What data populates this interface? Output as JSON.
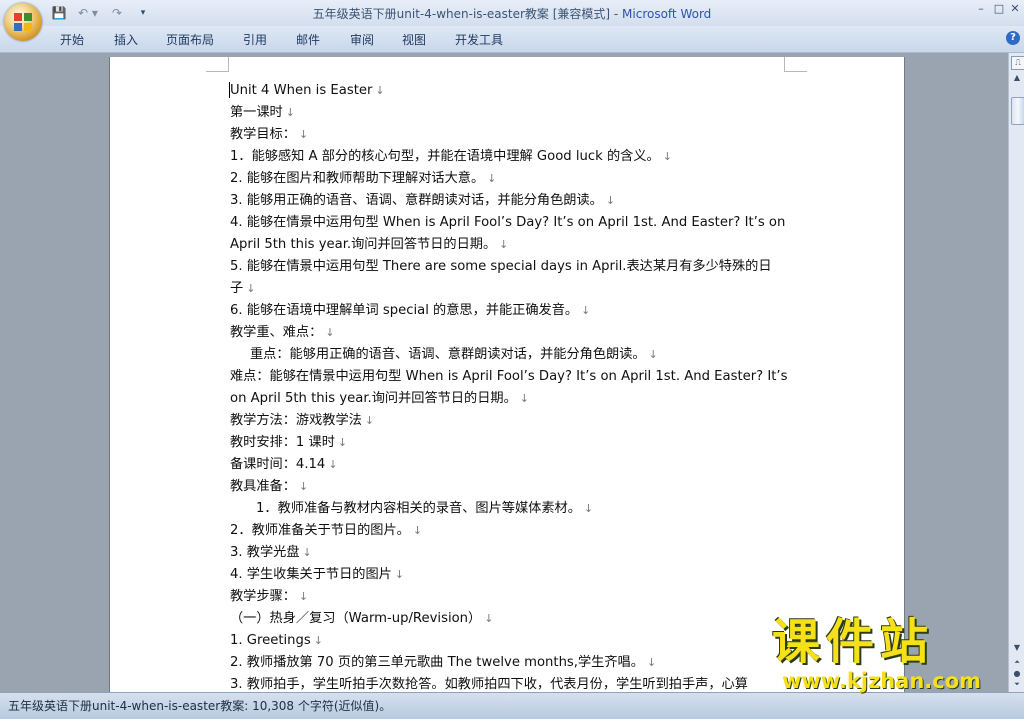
{
  "window": {
    "title_doc": "五年级英语下册unit-4-when-is-easter教案 [兼容模式] - ",
    "title_app": "Microsoft Word",
    "minimize": "–",
    "maximize": "□",
    "close": "✕"
  },
  "quick_access": {
    "save_icon": "💾",
    "undo_icon": "↶ ▾",
    "redo_icon": "↷",
    "customize_icon": "▾"
  },
  "ribbon": {
    "tabs": [
      "开始",
      "插入",
      "页面布局",
      "引用",
      "邮件",
      "审阅",
      "视图",
      "开发工具"
    ],
    "help_icon": "?"
  },
  "document": {
    "paragraph_mark": "↓",
    "lines": [
      {
        "text": "Unit 4 When is Easter",
        "indent": 0
      },
      {
        "text": "第一课时",
        "indent": 0
      },
      {
        "text": "教学目标：",
        "indent": 0
      },
      {
        "text": "1．能够感知 A 部分的核心句型，并能在语境中理解 Good luck 的含义。",
        "indent": 0
      },
      {
        "text": "2. 能够在图片和教师帮助下理解对话大意。",
        "indent": 0
      },
      {
        "text": "3. 能够用正确的语音、语调、意群朗读对话，并能分角色朗读。",
        "indent": 0
      },
      {
        "text": "4. 能够在情景中运用句型 When is April Fool’s Day? It’s on April 1st. And Easter? It’s on",
        "indent": 0,
        "nomark": true
      },
      {
        "text": "April 5th this year.询问并回答节日的日期。",
        "indent": 0
      },
      {
        "text": "5. 能够在情景中运用句型 There are some special days in April.表达某月有多少特殊的日",
        "indent": 0,
        "nomark": true
      },
      {
        "text": "子",
        "indent": 0
      },
      {
        "text": "6. 能够在语境中理解单词 special 的意思，并能正确发音。",
        "indent": 0
      },
      {
        "text": "教学重、难点：",
        "indent": 0
      },
      {
        "text": "重点：能够用正确的语音、语调、意群朗读对话，并能分角色朗读。",
        "indent": 1
      },
      {
        "text": "难点：能够在情景中运用句型 When is April Fool’s Day? It’s on April 1st. And Easter? It’s",
        "indent": 0,
        "nomark": true
      },
      {
        "text": "on April 5th this year.询问并回答节日的日期。",
        "indent": 0
      },
      {
        "text": "教学方法：游戏教学法",
        "indent": 0
      },
      {
        "text": "教时安排：1 课时",
        "indent": 0
      },
      {
        "text": "备课时间：4.14",
        "indent": 0
      },
      {
        "text": "教具准备：",
        "indent": 0
      },
      {
        "text": "1．教师准备与教材内容相关的录音、图片等媒体素材。",
        "indent": 2
      },
      {
        "text": "2．教师准备关于节日的图片。",
        "indent": 0
      },
      {
        "text": "3. 教学光盘",
        "indent": 0
      },
      {
        "text": "4. 学生收集关于节日的图片",
        "indent": 0
      },
      {
        "text": "教学步骤：",
        "indent": 0
      },
      {
        "text": "（一）热身／复习（Warm-up/Revision）",
        "indent": 0
      },
      {
        "text": "1. Greetings",
        "indent": 0
      },
      {
        "text": "2. 教师播放第 70 页的第三单元歌曲 The twelve months,学生齐唱。",
        "indent": 0
      },
      {
        "text": "3. 教师拍手，学生听拍手次数抢答。如教师拍四下收，代表月份，学生听到拍手声，心算",
        "indent": 0,
        "nomark": true
      }
    ]
  },
  "watermark": {
    "title": "课件站",
    "url": "www.kjzhan.com"
  },
  "scrollbar": {
    "ruler_icon": "⎍",
    "up_icon": "▲",
    "down_icon": "▼",
    "prev_icon": "⏶",
    "browse_icon": "●",
    "next_icon": "⏷"
  },
  "status": {
    "text": "五年级英语下册unit-4-when-is-easter教案: 10,308 个字符(近似值)。"
  }
}
